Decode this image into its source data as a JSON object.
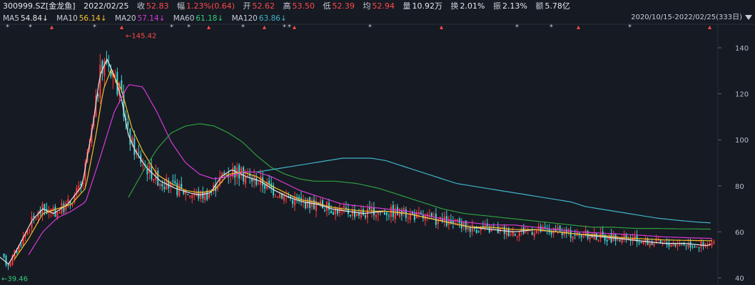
{
  "header": {
    "code": "300999.SZ[金龙鱼]",
    "date": "2022/02/25",
    "close_label": "收",
    "close": "52.83",
    "change_label": "幅",
    "change": "1.23%(0.64)",
    "open_label": "开",
    "open": "52.62",
    "high_label": "高",
    "high": "53.50",
    "low_label": "低",
    "low": "52.39",
    "avg_label": "均",
    "avg": "52.94",
    "vol_label": "量",
    "vol": "10.92万",
    "turn_label": "换",
    "turn": "2.01%",
    "amp_label": "振",
    "amp": "2.13%",
    "amt_label": "额",
    "amt": "5.78亿"
  },
  "ma": {
    "ma5_label": "MA5",
    "ma5": "54.84↓",
    "ma10_label": "MA10",
    "ma10": "56.14↓",
    "ma20_label": "MA20",
    "ma20": "57.14↓",
    "ma60_label": "MA60",
    "ma60": "61.18↓",
    "ma120_label": "MA120",
    "ma120": "63.86↓"
  },
  "range_label": "2020/10/15-2022/02/25(333日)",
  "colors": {
    "bg": "#161a23",
    "up": "#ff3b3b",
    "down": "#3fd4d4",
    "grid": "#2a2f3a",
    "ma5": "#e6e6e6",
    "ma10": "#f2c12e",
    "ma20": "#d63ad6",
    "ma60": "#2f9e3f",
    "ma120": "#3fb4c8"
  },
  "chart_data": {
    "type": "line",
    "title": "300999.SZ[金龙鱼]",
    "ylim": [
      38,
      148
    ],
    "y_ticks": [
      40,
      60,
      80,
      100,
      120,
      140
    ],
    "annotations": [
      {
        "text": "←145.42",
        "value": 145.42
      },
      {
        "text": "←39.46",
        "value": 39.46
      }
    ],
    "x_count": 333,
    "grid": false,
    "series": [
      {
        "name": "MA5",
        "knots": [
          [
            0,
            49
          ],
          [
            12,
            46
          ],
          [
            25,
            53
          ],
          [
            45,
            65
          ],
          [
            60,
            70
          ],
          [
            75,
            68
          ],
          [
            95,
            72
          ],
          [
            115,
            80
          ],
          [
            130,
            106
          ],
          [
            140,
            128
          ],
          [
            150,
            135
          ],
          [
            160,
            128
          ],
          [
            170,
            118
          ],
          [
            180,
            102
          ],
          [
            190,
            95
          ],
          [
            205,
            88
          ],
          [
            225,
            82
          ],
          [
            245,
            79
          ],
          [
            265,
            77
          ],
          [
            280,
            76
          ],
          [
            295,
            77
          ],
          [
            310,
            84
          ],
          [
            325,
            87
          ],
          [
            345,
            84
          ],
          [
            365,
            82
          ],
          [
            385,
            78
          ],
          [
            405,
            75
          ],
          [
            425,
            73
          ],
          [
            445,
            72
          ],
          [
            465,
            70
          ],
          [
            485,
            69
          ],
          [
            510,
            68
          ],
          [
            540,
            69
          ],
          [
            570,
            68
          ],
          [
            600,
            66
          ],
          [
            630,
            64
          ],
          [
            660,
            62
          ],
          [
            690,
            61
          ],
          [
            720,
            60
          ],
          [
            750,
            61
          ],
          [
            780,
            60
          ],
          [
            810,
            59
          ],
          [
            840,
            58
          ],
          [
            870,
            57
          ],
          [
            900,
            56
          ],
          [
            930,
            55
          ],
          [
            960,
            55
          ],
          [
            990,
            54
          ],
          [
            998,
            54.84
          ]
        ]
      },
      {
        "name": "MA10",
        "knots": [
          [
            20,
            48
          ],
          [
            40,
            57
          ],
          [
            60,
            68
          ],
          [
            80,
            70
          ],
          [
            100,
            72
          ],
          [
            120,
            79
          ],
          [
            135,
            103
          ],
          [
            145,
            122
          ],
          [
            155,
            130
          ],
          [
            170,
            122
          ],
          [
            185,
            105
          ],
          [
            200,
            95
          ],
          [
            220,
            85
          ],
          [
            240,
            81
          ],
          [
            260,
            78
          ],
          [
            280,
            77
          ],
          [
            300,
            78
          ],
          [
            320,
            85
          ],
          [
            340,
            86
          ],
          [
            360,
            84
          ],
          [
            380,
            80
          ],
          [
            400,
            77
          ],
          [
            420,
            74
          ],
          [
            440,
            73
          ],
          [
            460,
            71
          ],
          [
            480,
            70
          ],
          [
            510,
            69
          ],
          [
            540,
            69
          ],
          [
            570,
            68
          ],
          [
            600,
            66
          ],
          [
            630,
            64
          ],
          [
            660,
            62
          ],
          [
            690,
            62
          ],
          [
            720,
            61
          ],
          [
            750,
            61
          ],
          [
            780,
            60
          ],
          [
            810,
            59
          ],
          [
            840,
            58.5
          ],
          [
            870,
            57.5
          ],
          [
            900,
            57
          ],
          [
            930,
            56.5
          ],
          [
            960,
            56.3
          ],
          [
            998,
            56.14
          ]
        ]
      },
      {
        "name": "MA20",
        "knots": [
          [
            40,
            50
          ],
          [
            60,
            60
          ],
          [
            80,
            66
          ],
          [
            100,
            69
          ],
          [
            120,
            73
          ],
          [
            140,
            92
          ],
          [
            160,
            112
          ],
          [
            180,
            124
          ],
          [
            200,
            123
          ],
          [
            220,
            112
          ],
          [
            240,
            99
          ],
          [
            260,
            90
          ],
          [
            280,
            85
          ],
          [
            300,
            83
          ],
          [
            320,
            84
          ],
          [
            340,
            86
          ],
          [
            360,
            86
          ],
          [
            380,
            84
          ],
          [
            400,
            81
          ],
          [
            420,
            78
          ],
          [
            440,
            76
          ],
          [
            460,
            74
          ],
          [
            480,
            72
          ],
          [
            510,
            71
          ],
          [
            540,
            70
          ],
          [
            570,
            69
          ],
          [
            600,
            67
          ],
          [
            630,
            65
          ],
          [
            660,
            64
          ],
          [
            690,
            63
          ],
          [
            720,
            63
          ],
          [
            750,
            62
          ],
          [
            780,
            61
          ],
          [
            810,
            60
          ],
          [
            840,
            59.5
          ],
          [
            870,
            59
          ],
          [
            900,
            58.5
          ],
          [
            930,
            57.8
          ],
          [
            960,
            57.5
          ],
          [
            998,
            57.14
          ]
        ]
      },
      {
        "name": "MA60",
        "knots": [
          [
            180,
            75
          ],
          [
            200,
            86
          ],
          [
            220,
            96
          ],
          [
            240,
            103
          ],
          [
            260,
            106
          ],
          [
            280,
            107
          ],
          [
            300,
            106
          ],
          [
            320,
            103
          ],
          [
            340,
            99
          ],
          [
            360,
            93
          ],
          [
            380,
            88
          ],
          [
            400,
            85
          ],
          [
            420,
            83
          ],
          [
            440,
            82
          ],
          [
            470,
            82
          ],
          [
            500,
            81
          ],
          [
            530,
            79
          ],
          [
            560,
            76
          ],
          [
            590,
            73
          ],
          [
            620,
            70
          ],
          [
            650,
            68
          ],
          [
            680,
            67
          ],
          [
            710,
            66
          ],
          [
            740,
            65
          ],
          [
            770,
            64
          ],
          [
            800,
            63
          ],
          [
            830,
            62
          ],
          [
            860,
            62
          ],
          [
            890,
            61.5
          ],
          [
            920,
            61.5
          ],
          [
            950,
            61.3
          ],
          [
            998,
            61.18
          ]
        ]
      },
      {
        "name": "MA120",
        "knots": [
          [
            360,
            86
          ],
          [
            380,
            87
          ],
          [
            400,
            88
          ],
          [
            420,
            89
          ],
          [
            440,
            90
          ],
          [
            460,
            91
          ],
          [
            480,
            92
          ],
          [
            500,
            92
          ],
          [
            520,
            92
          ],
          [
            540,
            91
          ],
          [
            560,
            89
          ],
          [
            580,
            87
          ],
          [
            600,
            85
          ],
          [
            620,
            83
          ],
          [
            640,
            81
          ],
          [
            660,
            80
          ],
          [
            680,
            79
          ],
          [
            700,
            78
          ],
          [
            720,
            77
          ],
          [
            740,
            76
          ],
          [
            760,
            75
          ],
          [
            780,
            74
          ],
          [
            800,
            73
          ],
          [
            820,
            71
          ],
          [
            840,
            70
          ],
          [
            860,
            69
          ],
          [
            880,
            68
          ],
          [
            900,
            67
          ],
          [
            920,
            66
          ],
          [
            950,
            65
          ],
          [
            975,
            64.3
          ],
          [
            998,
            63.86
          ]
        ]
      }
    ]
  }
}
